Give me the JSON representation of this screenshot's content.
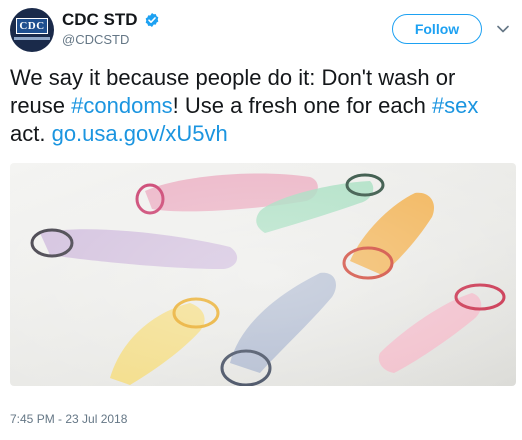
{
  "account": {
    "display_name": "CDC STD",
    "handle": "@CDCSTD",
    "avatar_text": "CDC",
    "verified": true
  },
  "follow_button": {
    "label": "Follow"
  },
  "tweet": {
    "text_parts": [
      {
        "type": "text",
        "value": "We say it because people do it: Don't wash or reuse "
      },
      {
        "type": "hashtag",
        "value": "#condoms"
      },
      {
        "type": "text",
        "value": "! Use a fresh one for each "
      },
      {
        "type": "hashtag",
        "value": "#sex"
      },
      {
        "type": "text",
        "value": " act. "
      },
      {
        "type": "link",
        "value": "go.usa.gov/xU5vh"
      }
    ],
    "timestamp": "7:45 PM - 23 Jul 2018"
  },
  "media": {
    "description_icons": [
      "condom-pink",
      "condom-purple",
      "condom-green",
      "condom-orange",
      "condom-yellow",
      "condom-blue",
      "condom-light-pink"
    ],
    "colors": {
      "pink": "#e07a9a",
      "purple": "#b79bc8",
      "green": "#8fd1b0",
      "orange": "#f0a640",
      "yellow": "#f3d56a",
      "blue": "#9aa7c2",
      "light_pink": "#efb3c3"
    }
  },
  "colors": {
    "accent": "#1da1f2",
    "link": "#1b95e0",
    "muted": "#657786",
    "text": "#14171a"
  }
}
